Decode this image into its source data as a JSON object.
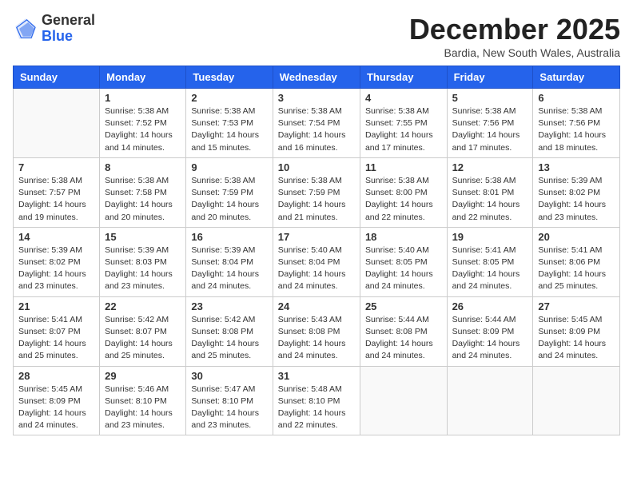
{
  "header": {
    "logo_general": "General",
    "logo_blue": "Blue",
    "month_title": "December 2025",
    "location": "Bardia, New South Wales, Australia"
  },
  "days_of_week": [
    "Sunday",
    "Monday",
    "Tuesday",
    "Wednesday",
    "Thursday",
    "Friday",
    "Saturday"
  ],
  "weeks": [
    [
      {
        "day": "",
        "info": ""
      },
      {
        "day": "1",
        "info": "Sunrise: 5:38 AM\nSunset: 7:52 PM\nDaylight: 14 hours\nand 14 minutes."
      },
      {
        "day": "2",
        "info": "Sunrise: 5:38 AM\nSunset: 7:53 PM\nDaylight: 14 hours\nand 15 minutes."
      },
      {
        "day": "3",
        "info": "Sunrise: 5:38 AM\nSunset: 7:54 PM\nDaylight: 14 hours\nand 16 minutes."
      },
      {
        "day": "4",
        "info": "Sunrise: 5:38 AM\nSunset: 7:55 PM\nDaylight: 14 hours\nand 17 minutes."
      },
      {
        "day": "5",
        "info": "Sunrise: 5:38 AM\nSunset: 7:56 PM\nDaylight: 14 hours\nand 17 minutes."
      },
      {
        "day": "6",
        "info": "Sunrise: 5:38 AM\nSunset: 7:56 PM\nDaylight: 14 hours\nand 18 minutes."
      }
    ],
    [
      {
        "day": "7",
        "info": "Sunrise: 5:38 AM\nSunset: 7:57 PM\nDaylight: 14 hours\nand 19 minutes."
      },
      {
        "day": "8",
        "info": "Sunrise: 5:38 AM\nSunset: 7:58 PM\nDaylight: 14 hours\nand 20 minutes."
      },
      {
        "day": "9",
        "info": "Sunrise: 5:38 AM\nSunset: 7:59 PM\nDaylight: 14 hours\nand 20 minutes."
      },
      {
        "day": "10",
        "info": "Sunrise: 5:38 AM\nSunset: 7:59 PM\nDaylight: 14 hours\nand 21 minutes."
      },
      {
        "day": "11",
        "info": "Sunrise: 5:38 AM\nSunset: 8:00 PM\nDaylight: 14 hours\nand 22 minutes."
      },
      {
        "day": "12",
        "info": "Sunrise: 5:38 AM\nSunset: 8:01 PM\nDaylight: 14 hours\nand 22 minutes."
      },
      {
        "day": "13",
        "info": "Sunrise: 5:39 AM\nSunset: 8:02 PM\nDaylight: 14 hours\nand 23 minutes."
      }
    ],
    [
      {
        "day": "14",
        "info": "Sunrise: 5:39 AM\nSunset: 8:02 PM\nDaylight: 14 hours\nand 23 minutes."
      },
      {
        "day": "15",
        "info": "Sunrise: 5:39 AM\nSunset: 8:03 PM\nDaylight: 14 hours\nand 23 minutes."
      },
      {
        "day": "16",
        "info": "Sunrise: 5:39 AM\nSunset: 8:04 PM\nDaylight: 14 hours\nand 24 minutes."
      },
      {
        "day": "17",
        "info": "Sunrise: 5:40 AM\nSunset: 8:04 PM\nDaylight: 14 hours\nand 24 minutes."
      },
      {
        "day": "18",
        "info": "Sunrise: 5:40 AM\nSunset: 8:05 PM\nDaylight: 14 hours\nand 24 minutes."
      },
      {
        "day": "19",
        "info": "Sunrise: 5:41 AM\nSunset: 8:05 PM\nDaylight: 14 hours\nand 24 minutes."
      },
      {
        "day": "20",
        "info": "Sunrise: 5:41 AM\nSunset: 8:06 PM\nDaylight: 14 hours\nand 25 minutes."
      }
    ],
    [
      {
        "day": "21",
        "info": "Sunrise: 5:41 AM\nSunset: 8:07 PM\nDaylight: 14 hours\nand 25 minutes."
      },
      {
        "day": "22",
        "info": "Sunrise: 5:42 AM\nSunset: 8:07 PM\nDaylight: 14 hours\nand 25 minutes."
      },
      {
        "day": "23",
        "info": "Sunrise: 5:42 AM\nSunset: 8:08 PM\nDaylight: 14 hours\nand 25 minutes."
      },
      {
        "day": "24",
        "info": "Sunrise: 5:43 AM\nSunset: 8:08 PM\nDaylight: 14 hours\nand 24 minutes."
      },
      {
        "day": "25",
        "info": "Sunrise: 5:44 AM\nSunset: 8:08 PM\nDaylight: 14 hours\nand 24 minutes."
      },
      {
        "day": "26",
        "info": "Sunrise: 5:44 AM\nSunset: 8:09 PM\nDaylight: 14 hours\nand 24 minutes."
      },
      {
        "day": "27",
        "info": "Sunrise: 5:45 AM\nSunset: 8:09 PM\nDaylight: 14 hours\nand 24 minutes."
      }
    ],
    [
      {
        "day": "28",
        "info": "Sunrise: 5:45 AM\nSunset: 8:09 PM\nDaylight: 14 hours\nand 24 minutes."
      },
      {
        "day": "29",
        "info": "Sunrise: 5:46 AM\nSunset: 8:10 PM\nDaylight: 14 hours\nand 23 minutes."
      },
      {
        "day": "30",
        "info": "Sunrise: 5:47 AM\nSunset: 8:10 PM\nDaylight: 14 hours\nand 23 minutes."
      },
      {
        "day": "31",
        "info": "Sunrise: 5:48 AM\nSunset: 8:10 PM\nDaylight: 14 hours\nand 22 minutes."
      },
      {
        "day": "",
        "info": ""
      },
      {
        "day": "",
        "info": ""
      },
      {
        "day": "",
        "info": ""
      }
    ]
  ]
}
